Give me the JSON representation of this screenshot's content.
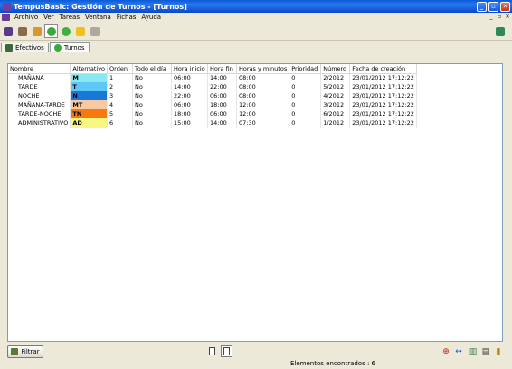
{
  "window": {
    "title": "TempusBasic: Gestión de Turnos - [Turnos]"
  },
  "menu": {
    "items": [
      "Archivo",
      "Ver",
      "Tareas",
      "Ventana",
      "Fichas",
      "Ayuda"
    ]
  },
  "tabs": [
    {
      "label": "Efectivos",
      "icon": "roster-icon",
      "active": false
    },
    {
      "label": "Turnos",
      "icon": "shifts-icon",
      "active": true
    }
  ],
  "table": {
    "columns": [
      "Nombre",
      "Alternativo",
      "Orden",
      "Todo el día",
      "Hora inicio",
      "Hora fin",
      "Horas y minutos",
      "Prioridad",
      "Número",
      "Fecha de creación"
    ],
    "rows": [
      {
        "nombre": "MAÑANA",
        "alternativo": "M",
        "alt_color": "#8ce8f0",
        "orden": "1",
        "todo_dia": "No",
        "inicio": "06:00",
        "fin": "14:00",
        "horas": "08:00",
        "prioridad": "0",
        "numero": "2/2012",
        "fecha": "23/01/2012 17:12:22"
      },
      {
        "nombre": "TARDE",
        "alternativo": "T",
        "alt_color": "#5cc8f8",
        "orden": "2",
        "todo_dia": "No",
        "inicio": "14:00",
        "fin": "22:00",
        "horas": "08:00",
        "prioridad": "0",
        "numero": "5/2012",
        "fecha": "23/01/2012 17:12:22"
      },
      {
        "nombre": "NOCHE",
        "alternativo": "N",
        "alt_color": "#1878d8",
        "orden": "3",
        "todo_dia": "No",
        "inicio": "22:00",
        "fin": "06:00",
        "horas": "08:00",
        "prioridad": "0",
        "numero": "4/2012",
        "fecha": "23/01/2012 17:12:22"
      },
      {
        "nombre": "MAÑANA-TARDE",
        "alternativo": "MT",
        "alt_color": "#f8c8a0",
        "orden": "4",
        "todo_dia": "No",
        "inicio": "06:00",
        "fin": "18:00",
        "horas": "12:00",
        "prioridad": "0",
        "numero": "3/2012",
        "fecha": "23/01/2012 17:12:22"
      },
      {
        "nombre": "TARDE-NOCHE",
        "alternativo": "TN",
        "alt_color": "#f87810",
        "orden": "5",
        "todo_dia": "No",
        "inicio": "18:00",
        "fin": "06:00",
        "horas": "12:00",
        "prioridad": "0",
        "numero": "6/2012",
        "fecha": "23/01/2012 17:12:22"
      },
      {
        "nombre": "ADMINISTRATIVO",
        "alternativo": "AD",
        "alt_color": "#f8f880",
        "orden": "6",
        "todo_dia": "No",
        "inicio": "15:00",
        "fin": "14:00",
        "horas": "07:30",
        "prioridad": "0",
        "numero": "1/2012",
        "fecha": "23/01/2012 17:12:22"
      }
    ]
  },
  "bottom": {
    "filter_label": "Filtrar"
  },
  "status": {
    "text": "Elementos encontrados : 6"
  },
  "colors": {
    "titlebar": "#0a5ad6",
    "grid_border": "#7f9db9",
    "background": "#ece9d8"
  }
}
